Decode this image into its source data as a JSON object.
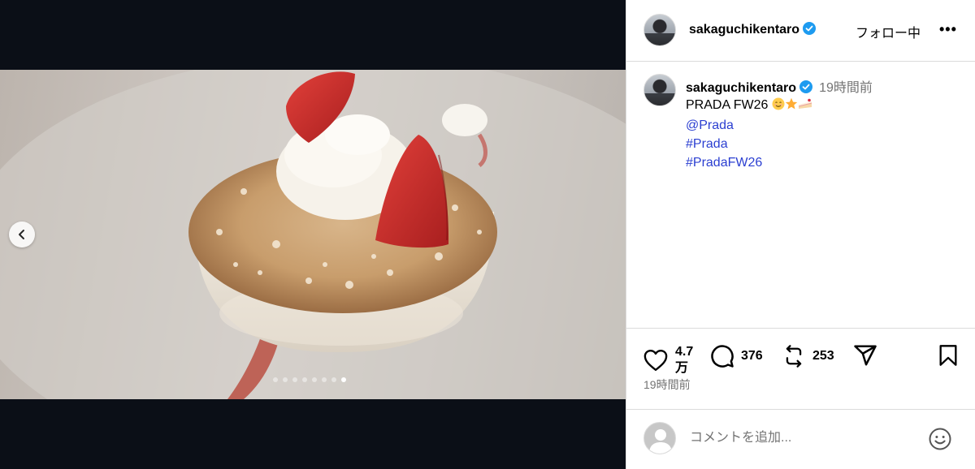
{
  "post": {
    "username": "sakaguchikentaro",
    "follow_label": "フォロー中",
    "more_label": "•••",
    "caption_time": "19時間前",
    "caption_title": "PRADA  FW26",
    "caption_emojis": [
      "smiling-face",
      "star",
      "cake"
    ],
    "mention": "@Prada",
    "hashtags": [
      "#Prada",
      "#PradaFW26"
    ],
    "likes": "4.7万",
    "comments": "376",
    "reposts": "253",
    "post_time": "19時間前",
    "comment_placeholder": "コメントを追加..."
  },
  "carousel": {
    "slide_count": 8,
    "active_index": 7
  },
  "colors": {
    "link": "#2b3fd1",
    "verified": "#1d9bf0",
    "muted": "#737373",
    "border": "#dbdbdb",
    "media_bg": "#0b0f17"
  }
}
